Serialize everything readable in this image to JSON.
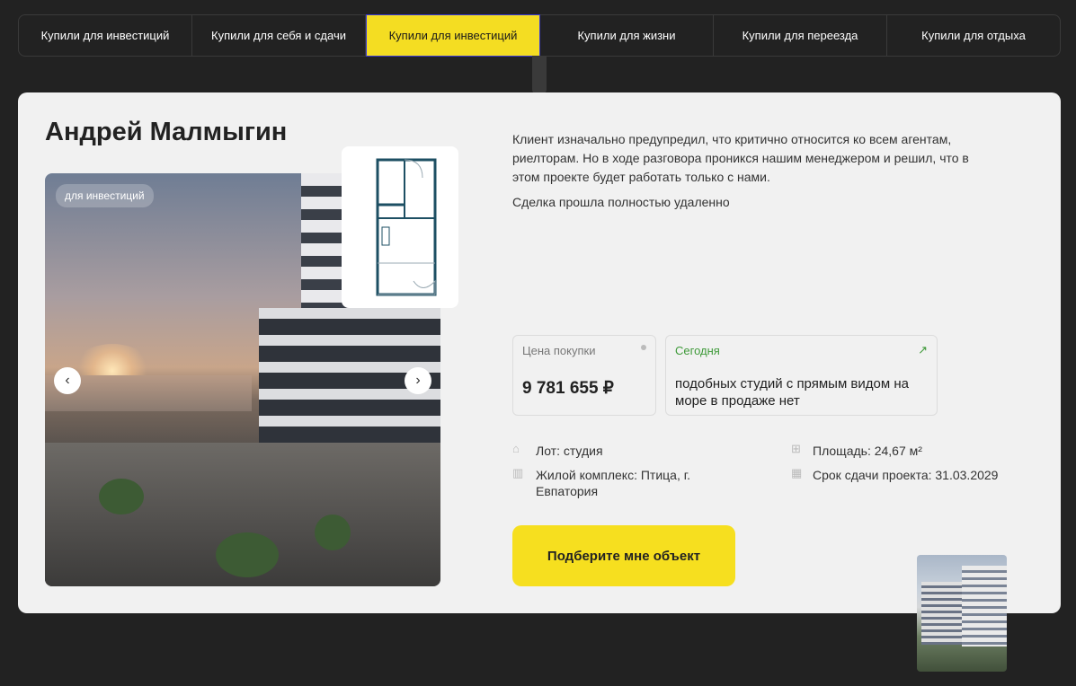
{
  "tabs": [
    {
      "label": "Купили для инвестиций"
    },
    {
      "label": "Купили для себя и сдачи"
    },
    {
      "label": "Купили для инвестиций"
    },
    {
      "label": "Купили для жизни"
    },
    {
      "label": "Купили для переезда"
    },
    {
      "label": "Купили для отдыха"
    }
  ],
  "active_tab_index": 2,
  "card": {
    "name": "Андрей Малмыгин",
    "photo_badge": "для инвестиций",
    "description": "Клиент изначально предупредил, что критично относится ко всем агентам, риелторам. Но в ходе разговора проникся нашим менеджером и решил, что в этом проекте будет работать только с нами.",
    "description2": "Сделка прошла полностью удаленно",
    "price_label": "Цена покупки",
    "price_value": "9 781 655 ₽",
    "today_label": "Сегодня",
    "today_text": "подобных студий с прямым видом на море в продаже нет",
    "lot": "Лот: студия",
    "area": "Площадь: 24,67 м²",
    "complex": "Жилой комплекс: Птица, г. Евпатория",
    "deadline": "Срок сдачи проекта: 31.03.2029",
    "cta": "Подберите мне объект"
  },
  "colors": {
    "accent": "#f6df1f",
    "background": "#222222",
    "card": "#f1f1f1",
    "trend": "#3f9a3a"
  },
  "icons": [
    "arrow-left-icon",
    "arrow-right-icon",
    "house-icon",
    "building-icon",
    "grid-icon",
    "calendar-icon",
    "trend-up-icon"
  ]
}
